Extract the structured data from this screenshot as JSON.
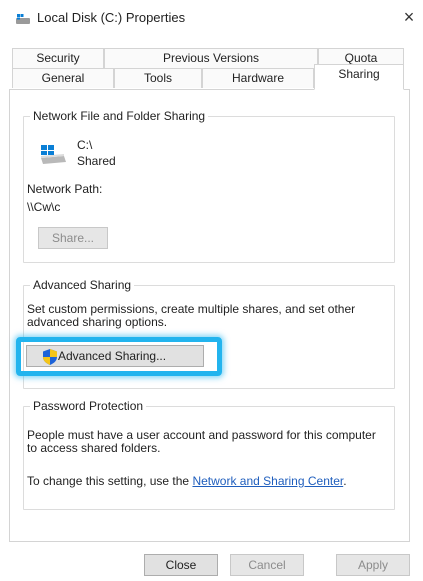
{
  "window": {
    "title": "Local Disk (C:) Properties",
    "close_glyph": "×"
  },
  "tabs_row1": [
    "Security",
    "Previous Versions",
    "Quota"
  ],
  "tabs_row2": [
    "General",
    "Tools",
    "Hardware",
    "Sharing"
  ],
  "active_tab": "Sharing",
  "network_sharing": {
    "legend": "Network File and Folder Sharing",
    "drive_name": "C:\\",
    "drive_status": "Shared",
    "path_label": "Network Path:",
    "path_value": "\\\\Cw\\c",
    "share_button": "Share..."
  },
  "advanced_sharing": {
    "legend": "Advanced Sharing",
    "description": "Set custom permissions, create multiple shares, and set other advanced sharing options.",
    "button": "Advanced Sharing..."
  },
  "password_protection": {
    "legend": "Password Protection",
    "description": "People must have a user account and password for this computer to access shared folders.",
    "change_prefix": "To change this setting, use the ",
    "link_text": "Network and Sharing Center",
    "change_suffix": "."
  },
  "buttons": {
    "close": "Close",
    "cancel": "Cancel",
    "apply": "Apply"
  },
  "colors": {
    "highlight": "#22b4ee",
    "link": "#1f5ebd"
  }
}
